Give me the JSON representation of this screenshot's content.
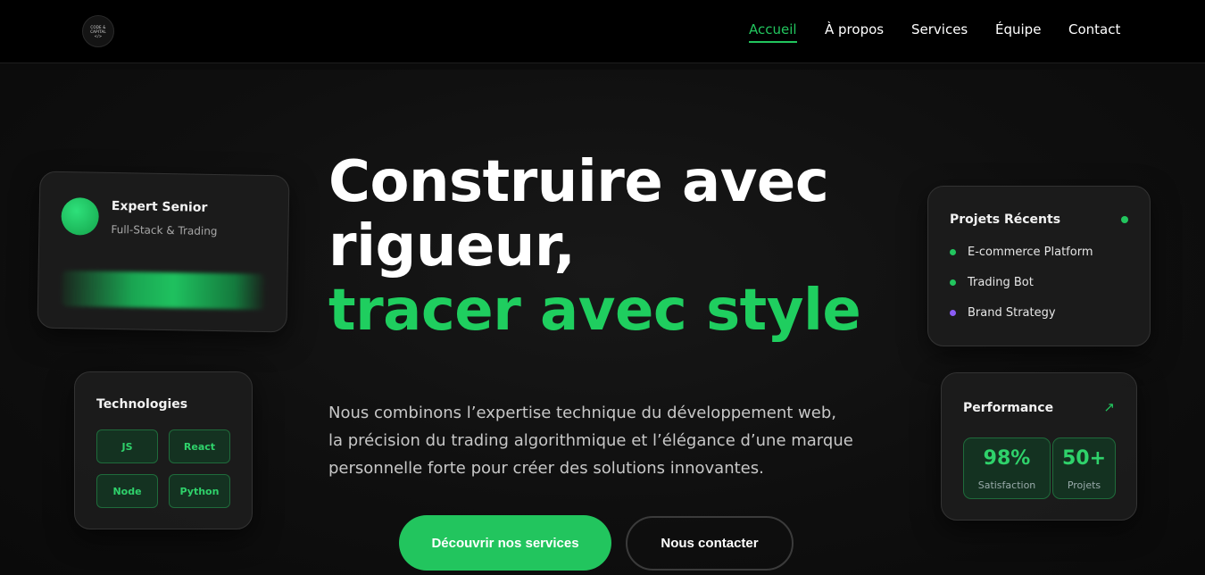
{
  "nav": {
    "logo": {
      "line1": "CODE &",
      "line2": "CAPITAL",
      "line3": "</>"
    },
    "links": [
      "Accueil",
      "À propos",
      "Services",
      "Équipe",
      "Contact"
    ],
    "active": "Accueil"
  },
  "hero": {
    "headline_line1": "Construire avec",
    "headline_line2": "rigueur,",
    "headline_line3": "tracer avec style",
    "description_lines": [
      "Nous combinons l’expertise technique du développement web,",
      "la précision du trading algorithmique et l’élégance d’une marque",
      "personnelle forte pour créer des solutions innovantes."
    ],
    "primary_button": "Découvrir nos services",
    "secondary_button": "Nous contacter"
  },
  "expert_card": {
    "name": "Expert Senior",
    "role": "Full-Stack & Trading"
  },
  "tech_card": {
    "title": "Technologies",
    "tags": [
      "JS",
      "React",
      "Node",
      "Python"
    ]
  },
  "projects_card": {
    "title": "Projets Récents",
    "items": [
      {
        "label": "E-commerce Platform",
        "dot_color": "#22c55e"
      },
      {
        "label": "Trading Bot",
        "dot_color": "#22c55e"
      },
      {
        "label": "Brand Strategy",
        "dot_color": "#8b5cf6"
      }
    ]
  },
  "performance_card": {
    "title": "Performance",
    "icon": "trending-up-icon",
    "stats": [
      {
        "value": "98%",
        "label": "Satisfaction"
      },
      {
        "value": "50+",
        "label": "Projets"
      }
    ]
  },
  "colors": {
    "accent": "#22c55e",
    "purple": "#8b5cf6",
    "background": "#0b0b0b"
  }
}
